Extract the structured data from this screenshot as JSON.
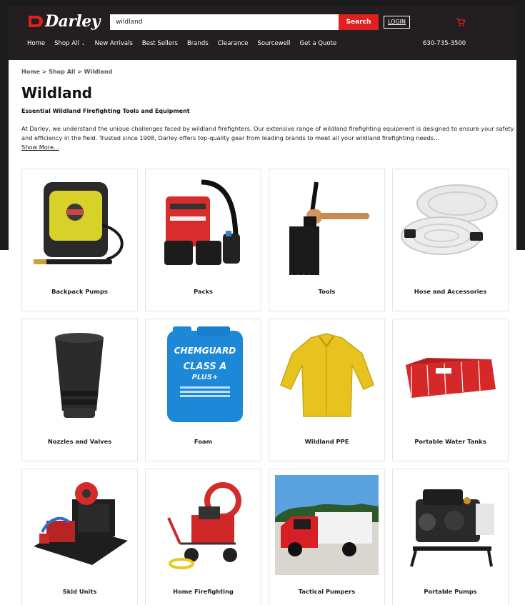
{
  "header": {
    "logo_text": "Darley",
    "search_value": "wildland",
    "search_button": "Search",
    "login_label": "LOGIN",
    "phone": "630-735-3500",
    "nav": [
      {
        "label": "Home"
      },
      {
        "label": "Shop All"
      },
      {
        "label": "New Arrivals"
      },
      {
        "label": "Best Sellers"
      },
      {
        "label": "Brands"
      },
      {
        "label": "Clearance"
      },
      {
        "label": "Sourcewell"
      },
      {
        "label": "Get a Quote"
      }
    ]
  },
  "breadcrumb": "Home > Shop All > Wildland",
  "page_title": "Wildland",
  "subtitle": "Essential Wildland Firefighting Tools and Equipment",
  "description": "At Darley, we understand the unique challenges faced by wildland firefighters. Our extensive range of wildland firefighting equipment is designed to ensure your safety and efficiency in the field. Trusted since 1908, Darley offers top-quality gear from leading brands to meet all your wildland firefighting needs...",
  "show_more": "Show More...",
  "categories": [
    {
      "label": "Backpack Pumps",
      "icon": "backpack-pump-image"
    },
    {
      "label": "Packs",
      "icon": "pack-image"
    },
    {
      "label": "Tools",
      "icon": "tool-image"
    },
    {
      "label": "Hose and Accessories",
      "icon": "hose-image"
    },
    {
      "label": "Nozzles and Valves",
      "icon": "nozzle-image"
    },
    {
      "label": "Foam",
      "icon": "foam-jug-image",
      "jug_brand": "CHEMGUARD",
      "jug_line": "CLASS A",
      "jug_sub": "PLUS+"
    },
    {
      "label": "Wildland PPE",
      "icon": "shirt-image"
    },
    {
      "label": "Portable Water Tanks",
      "icon": "water-tank-image"
    },
    {
      "label": "Skid Units",
      "icon": "skid-unit-image"
    },
    {
      "label": "Home Firefighting",
      "icon": "home-pump-image"
    },
    {
      "label": "Tactical Pumpers",
      "icon": "truck-image"
    },
    {
      "label": "Portable Pumps",
      "icon": "portable-pump-image"
    }
  ],
  "colors": {
    "header_bg": "#231f20",
    "accent_red": "#e0201f",
    "text": "#1b1b1b"
  }
}
